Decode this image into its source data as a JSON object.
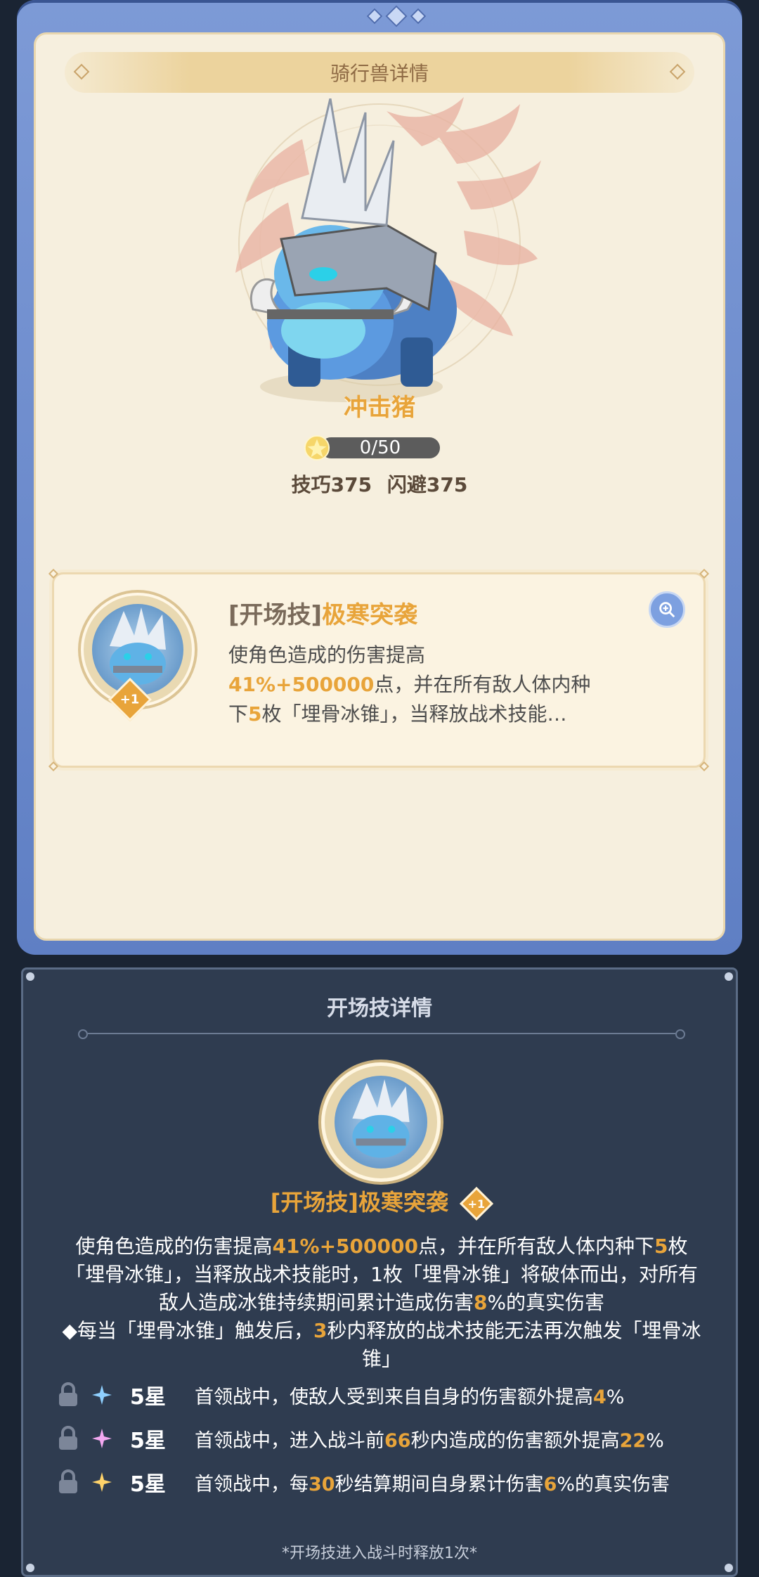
{
  "detail_panel": {
    "title": "骑行兽详情",
    "mount_name": "冲击猪",
    "progress": {
      "text": "0/50",
      "current": 0,
      "max": 50
    },
    "stats": {
      "skill_label": "技巧375",
      "dodge_label": "闪避375"
    },
    "skill_card": {
      "tag": "[开场技]",
      "name": "极寒突袭",
      "badge": "+1",
      "desc_line1": "使角色造成的伤害提高",
      "desc_hl1": "41%+500000",
      "desc_line2a": "点，并在所有敌人体内种",
      "desc_line3a": "下",
      "desc_hl2": "5",
      "desc_line3b": "枚「埋骨冰锥」，当释放战术技能…"
    }
  },
  "skill_detail": {
    "title": "开场技详情",
    "skill_title": "[开场技]极寒突袭",
    "badge": "+1",
    "desc": {
      "p1": "使角色造成的伤害提高",
      "h1": "41%+500000",
      "p2": "点，并在所有敌人体内种下",
      "h2": "5",
      "p3": "枚「埋骨冰锥」，当释放战术技能时，1枚「埋骨冰锥」将破体而出，对所有敌人造成冰锥持续期间累计造成伤害",
      "h3": "8",
      "p4": "%的真实伤害",
      "p5": "◆每当「埋骨冰锥」触发后，",
      "h4": "3",
      "p6": "秒内释放的战术技能无法再次触发「埋骨冰锥」"
    },
    "star_rows": [
      {
        "level": "5星",
        "sparkle_color": "#8fd0ff",
        "t1": "首领战中，使敌人受到来自自身的伤害额外提高",
        "h1": "4",
        "t2": "%",
        "h2": "",
        "t3": ""
      },
      {
        "level": "5星",
        "sparkle_color": "#f3a8f0",
        "t1": "首领战中，进入战斗前",
        "h1": "66",
        "t2": "秒内造成的伤害额外提高",
        "h2": "22",
        "t3": "%"
      },
      {
        "level": "5星",
        "sparkle_color": "#ffd36a",
        "t1": "首领战中，每",
        "h1": "30",
        "t2": "秒结算期间自身累计伤害",
        "h2": "6",
        "t3": "%的真实伤害"
      }
    ],
    "foot_note": "*开场技进入战斗时释放1次*"
  }
}
